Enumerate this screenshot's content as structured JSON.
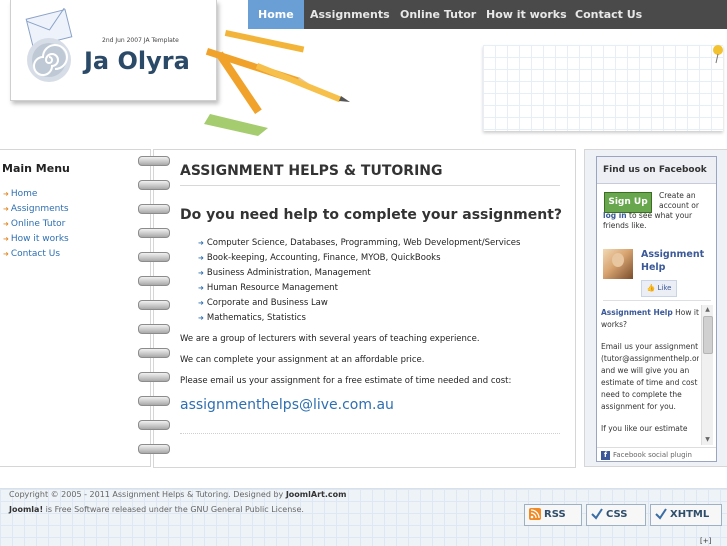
{
  "colors": {
    "nav_bg": "#4a4a4a",
    "nav_active": "#6a9fd6",
    "link": "#2d6fb1",
    "brand": "#2b4a67",
    "fb_blue": "#3b5998",
    "signup_green": "#69a74e"
  },
  "nav": {
    "items": [
      "Home",
      "Assignments",
      "Online Tutor",
      "How it works",
      "Contact Us"
    ],
    "active": "Home"
  },
  "logo": {
    "tagline": "2nd Jun 2007 JA Template",
    "brand": "Ja Olyra"
  },
  "sidebar": {
    "title": "Main Menu",
    "items": [
      {
        "label": "Home"
      },
      {
        "label": "Assignments"
      },
      {
        "label": "Online Tutor"
      },
      {
        "label": "How it works"
      },
      {
        "label": "Contact Us"
      }
    ]
  },
  "main": {
    "title": "ASSIGNMENT HELPS & TUTORING",
    "subheading": "Do you need help to complete your assignment?",
    "services": [
      "Computer Science, Databases, Programming, Web Development/Services",
      "Book-keeping, Accounting, Finance, MYOB, QuickBooks",
      "Business Administration, Management",
      "Human Resource Management",
      "Corporate and Business Law",
      "Mathematics, Statistics"
    ],
    "para1": "We are a group of lecturers with several years of teaching experience.",
    "para2": "We can complete your assignment at an affordable price.",
    "para3": "Please email us your assignment for a free estimate of time needed and cost:",
    "email": "assignmenthelps@live.com.au"
  },
  "facebook": {
    "header": "Find us on Facebook",
    "signup": "Sign Up",
    "create_text": "Create an account or",
    "login": "log in",
    "login_after": "to see what your friends like.",
    "page_name": "Assignment Help",
    "like": "Like",
    "feed_link": "Assignment Help",
    "feed_post1": "How it works?",
    "feed_post2": "Email us your assignment (tutor@assignmenthelp.org) and we will give you an estimate of time and cost need to complete the assignment for you.",
    "feed_post3": "If you like our estimate",
    "footer": "Facebook social plugin"
  },
  "footer": {
    "copy_prefix": "Copyright © 2005 - 2011 Assignment Helps & Tutoring. Designed by",
    "designer": "JoomlArt.com",
    "joomla": "Joomla!",
    "license": "is Free Software released under the GNU General Public License.",
    "badges": [
      "RSS",
      "CSS",
      "XHTML"
    ],
    "plus": "[+]"
  }
}
